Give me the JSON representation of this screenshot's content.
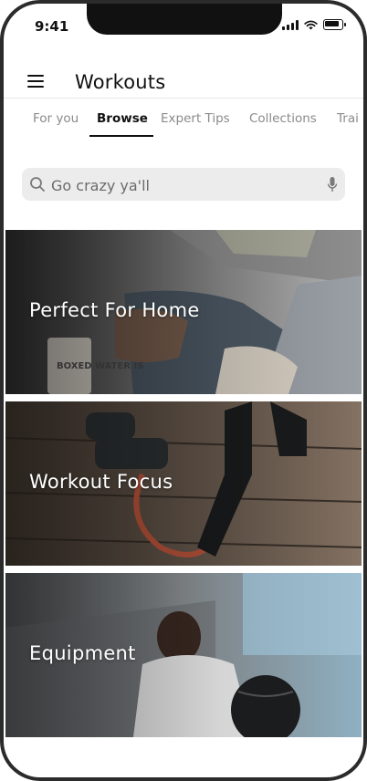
{
  "status_bar": {
    "time": "9:41"
  },
  "header": {
    "title": "Workouts"
  },
  "tabs": [
    {
      "label": "For you"
    },
    {
      "label": "Browse"
    },
    {
      "label": "Expert Tips"
    },
    {
      "label": "Collections"
    },
    {
      "label": "Trai"
    }
  ],
  "search": {
    "placeholder": "Go crazy ya'll"
  },
  "categories": [
    {
      "label": "Perfect For Home"
    },
    {
      "label": "Workout Focus"
    },
    {
      "label": "Equipment"
    }
  ],
  "image_text": {
    "carton": "BOXED WATER IS"
  },
  "colors": {
    "active_tab": "#111111",
    "inactive_tab": "#8a8a8a",
    "search_bg": "#ececec"
  }
}
